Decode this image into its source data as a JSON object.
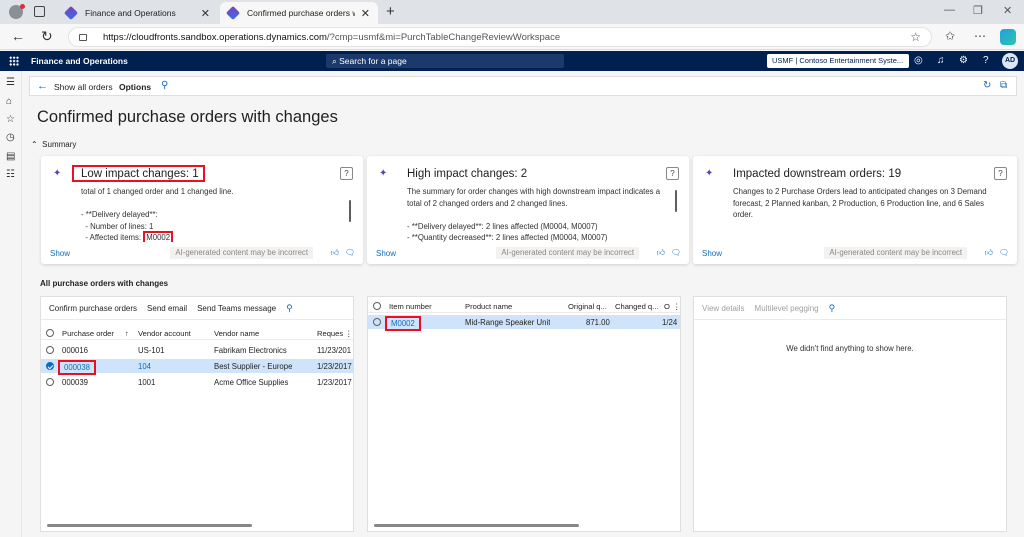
{
  "browser": {
    "tabs": [
      {
        "label": "Finance and Operations"
      },
      {
        "label": "Confirmed purchase orders with c"
      }
    ],
    "url_host": "https://cloudfronts.sandbox.operations.dynamics.com",
    "url_path": "/?cmp=usmf&mi=PurchTableChangeReviewWorkspace"
  },
  "app": {
    "name": "Finance and Operations",
    "search_placeholder": "Search for a page",
    "company": "USMF | Contoso Entertainment Syste...",
    "avatar_initials": "AD"
  },
  "action_bar": {
    "show_all_orders": "Show all orders",
    "options": "Options"
  },
  "page_title": "Confirmed purchase orders with changes",
  "summary_label": "Summary",
  "cards": [
    {
      "title": "Low impact changes: 1",
      "body_lines": [
        "total of 1 changed order and 1 changed line.",
        "",
        "- **Delivery delayed**:",
        "  - Number of lines: 1",
        "  - Affected items: "
      ],
      "highlight_item": "M0002",
      "show": "Show",
      "disclaimer": "AI-generated content may be incorrect"
    },
    {
      "title": "High impact changes: 2",
      "body_lines": [
        "The summary for order changes with high downstream impact indicates a",
        "total of 2 changed orders and 2 changed lines.",
        "",
        "- **Delivery delayed**: 2 lines affected (M0004, M0007)",
        "- **Quantity decreased**: 2 lines affected (M0004, M0007)"
      ],
      "show": "Show",
      "disclaimer": "AI-generated content may be incorrect"
    },
    {
      "title": "Impacted downstream orders: 19",
      "body_lines": [
        "Changes to 2 Purchase Orders lead to anticipated changes on 3 Demand",
        "forecast, 2 Planned kanban, 2 Production, 6 Production line, and 6 Sales",
        "order."
      ],
      "show": "Show",
      "disclaimer": "AI-generated content may be incorrect"
    }
  ],
  "orders_section_label": "All purchase orders with changes",
  "orders_toolbar": [
    "Confirm purchase orders",
    "Send email",
    "Send Teams message"
  ],
  "orders_columns": [
    "Purchase order",
    "Vendor account",
    "Vendor name",
    "Reques"
  ],
  "orders_rows": [
    {
      "po": "000016",
      "vendor": "US-101",
      "name": "Fabrikam Electronics",
      "req": "11/23/201"
    },
    {
      "po": "000038",
      "vendor": "104",
      "name": "Best Supplier - Europe",
      "req": "1/23/2017"
    },
    {
      "po": "000039",
      "vendor": "1001",
      "name": "Acme Office Supplies",
      "req": "1/23/2017"
    }
  ],
  "lines_columns": [
    "Item number",
    "Product name",
    "Original q...",
    "Changed q...",
    "O"
  ],
  "lines_rows": [
    {
      "item": "M0002",
      "product": "Mid-Range Speaker Unit",
      "orig": "871.00",
      "changed": "",
      "o": "1/24"
    }
  ],
  "details_toolbar": [
    "View details",
    "Multilevel pegging"
  ],
  "details_empty": "We didn't find anything to show here.",
  "colors": {
    "header": "#002050",
    "accent": "#0f6cbd",
    "highlight": "#e81123",
    "selected_row": "#cfe4fa"
  }
}
